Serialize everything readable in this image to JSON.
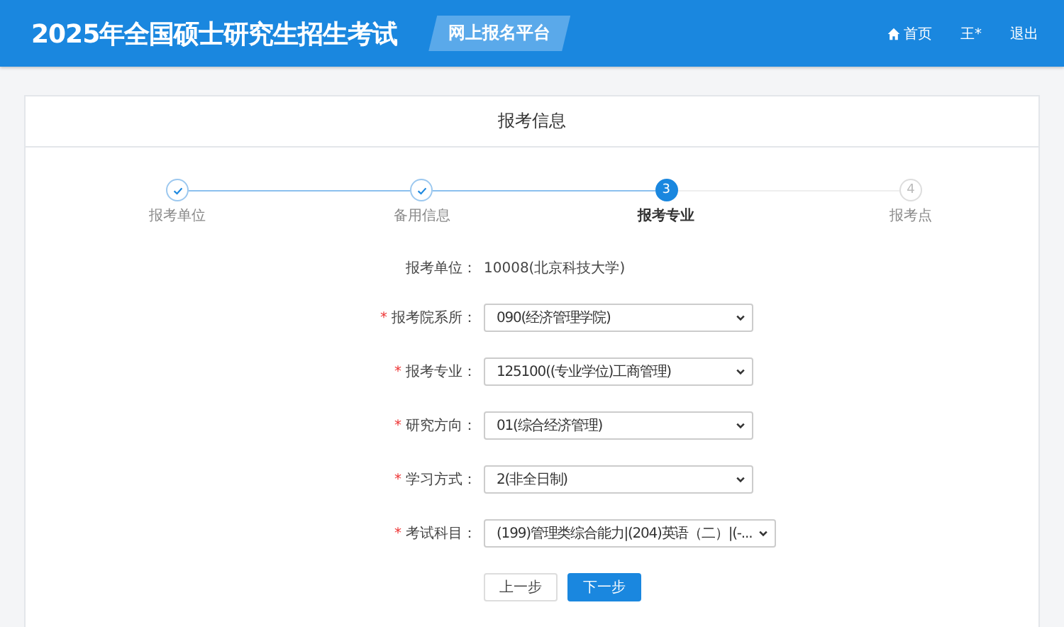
{
  "header": {
    "title": "2025年全国硕士研究生招生考试",
    "badge": "网上报名平台",
    "nav": [
      {
        "label": "首页"
      },
      {
        "label": "王*"
      },
      {
        "label": "退出"
      }
    ]
  },
  "card": {
    "title": "报考信息"
  },
  "steps": [
    {
      "label": "报考单位",
      "kind": "done"
    },
    {
      "label": "备用信息",
      "kind": "done"
    },
    {
      "label": "报考专业",
      "kind": "active",
      "number": "3"
    },
    {
      "label": "报考点",
      "kind": "pending",
      "number": "4"
    }
  ],
  "form": [
    {
      "kind": "text",
      "label": "报考单位：",
      "value": "10008(北京科技大学)"
    },
    {
      "kind": "select",
      "label": "报考院系所：",
      "mark": "*",
      "value": "090(经济管理学院)"
    },
    {
      "kind": "select",
      "label": "报考专业：",
      "mark": "*",
      "value": "125100((专业学位)工商管理)"
    },
    {
      "kind": "select",
      "label": "研究方向：",
      "mark": "*",
      "value": "01(综合经济管理)"
    },
    {
      "kind": "select",
      "label": "学习方式：",
      "mark": "*",
      "value": "2(非全日制)"
    },
    {
      "kind": "select",
      "label": "考试科目：",
      "mark": "*",
      "value": "(199)管理类综合能力|(204)英语（二）|(-..."
    }
  ],
  "buttons": [
    {
      "label": "上一步",
      "kind": "secondary"
    },
    {
      "label": "下一步",
      "kind": "primary"
    }
  ]
}
